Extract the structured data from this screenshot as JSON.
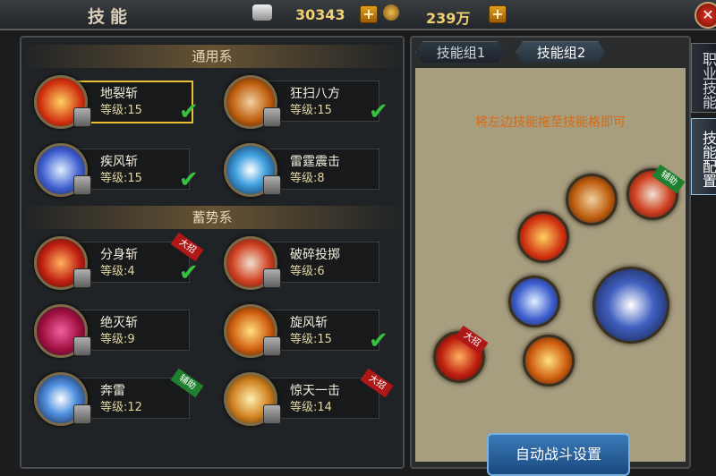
{
  "header": {
    "title": "技能",
    "silver": "30343",
    "gold": "239万"
  },
  "colors": {
    "accent": "#e8c030",
    "check": "#3ac040",
    "hint": "#d86a10"
  },
  "left": {
    "sections": [
      "通用系",
      "蓄势系"
    ],
    "skills": [
      {
        "name": "地裂斩",
        "level": "等级:15",
        "checked": true,
        "tag": ""
      },
      {
        "name": "狂扫八方",
        "level": "等级:15",
        "checked": true,
        "tag": ""
      },
      {
        "name": "疾风斩",
        "level": "等级:15",
        "checked": true,
        "tag": ""
      },
      {
        "name": "雷霆震击",
        "level": "等级:8",
        "checked": false,
        "tag": ""
      },
      {
        "name": "分身斩",
        "level": "等级:4",
        "checked": true,
        "tag": "大招"
      },
      {
        "name": "破碎投掷",
        "level": "等级:6",
        "checked": false,
        "tag": ""
      },
      {
        "name": "绝灭斩",
        "level": "等级:9",
        "checked": false,
        "tag": ""
      },
      {
        "name": "旋风斩",
        "level": "等级:15",
        "checked": true,
        "tag": ""
      },
      {
        "name": "奔雷",
        "level": "等级:12",
        "checked": false,
        "tag": "辅助"
      },
      {
        "name": "惊天一击",
        "level": "等级:14",
        "checked": false,
        "tag": "大招"
      }
    ]
  },
  "right": {
    "tabs": [
      "技能组1",
      "技能组2"
    ],
    "hint": "将左边技能拖至技能格即可",
    "auto_button": "自动战斗设置",
    "slot_tags": [
      "辅助",
      "大招"
    ]
  },
  "side_tabs": [
    "职业技能",
    "技能配置"
  ],
  "icons": [
    "silver-ingot-icon",
    "gold-coin-icon",
    "plus-icon",
    "close-icon",
    "check-icon",
    "lock-icon"
  ]
}
